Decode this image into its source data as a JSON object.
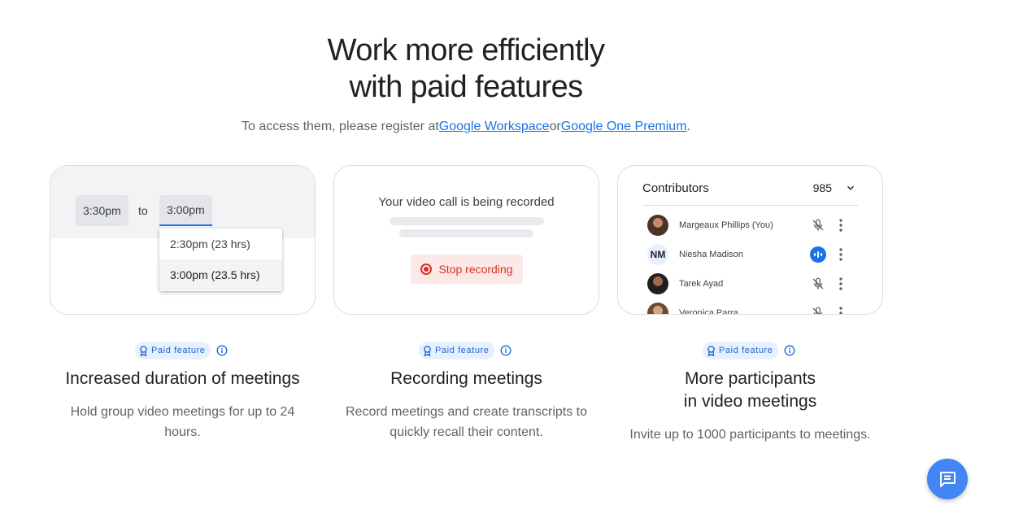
{
  "hero": {
    "title_line1": "Work more efficiently",
    "title_line2": "with paid features",
    "subtitle_prefix": "To access them, please register at",
    "link_workspace": "Google Workspace",
    "subtitle_or": "or",
    "link_one_premium": "Google One Premium",
    "subtitle_suffix": "."
  },
  "duration_card": {
    "start_time": "3:30pm",
    "to_label": "to",
    "end_time": "3:00pm",
    "options": [
      "2:30pm (23 hrs)",
      "3:00pm (23.5 hrs)"
    ],
    "selected_option": "3:00pm (23.5 hrs)"
  },
  "recording_card": {
    "status": "Your video call is being recorded",
    "stop_label": "Stop recording"
  },
  "participants_card": {
    "title": "Contributors",
    "count": "985",
    "people": [
      {
        "name": "Margeaux Phillips (You)",
        "avatar": "photo",
        "status": "muted"
      },
      {
        "name": "Niesha Madison",
        "initials": "NM",
        "avatar": "initials",
        "status": "speaking"
      },
      {
        "name": "Tarek Ayad",
        "avatar": "photo",
        "status": "muted"
      },
      {
        "name": "Veronica Parra",
        "avatar": "photo",
        "status": "muted"
      }
    ]
  },
  "features": [
    {
      "badge": "Paid feature",
      "title": "Increased duration of meetings",
      "title_line2": "",
      "description": "Hold group video meetings for up to 24 hours."
    },
    {
      "badge": "Paid feature",
      "title": "Recording meetings",
      "title_line2": "",
      "description": "Record meetings and create transcripts to quickly recall their content."
    },
    {
      "badge": "Paid feature",
      "title": "More participants",
      "title_line2": "in video meetings",
      "description": "Invite up to 1000 participants to meetings."
    }
  ],
  "colors": {
    "link": "#1a73e8",
    "record_red": "#d93025",
    "badge_bg": "#e8f0fe",
    "fab": "#4285f4"
  },
  "icons": {
    "badge": "award-ribbon-icon",
    "info": "info-circle-icon",
    "muted": "mic-off-icon",
    "speaking": "audio-wave-icon",
    "more": "more-vert-icon",
    "fab": "chat-message-icon"
  }
}
